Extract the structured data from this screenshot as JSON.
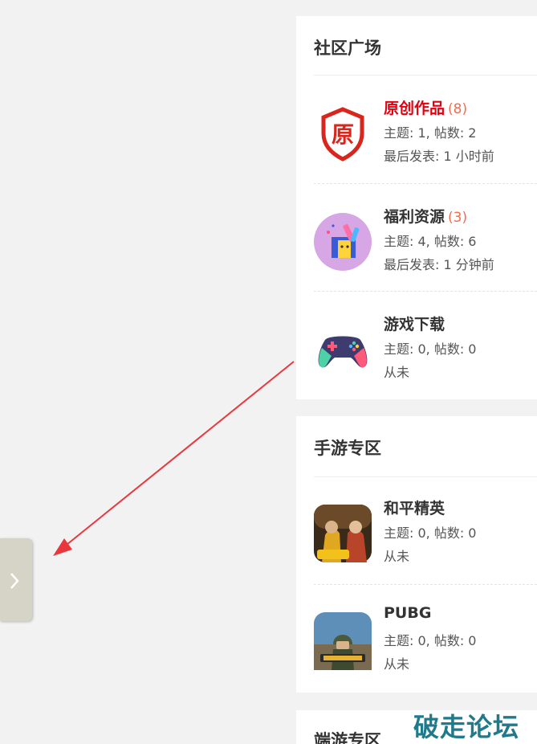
{
  "sections": [
    {
      "title": "社区广场",
      "forums": [
        {
          "name": "原创作品",
          "count": "(8)",
          "stats": "主题: 1, 帖数: 2",
          "last": "最后发表: 1 小时前",
          "icon": "shield-original-icon"
        },
        {
          "name": "福利资源",
          "count": "(3)",
          "stats": "主题: 4, 帖数: 6",
          "last": "最后发表: 1 分钟前",
          "icon": "gift-box-icon"
        },
        {
          "name": "游戏下载",
          "count": "",
          "stats": "主题: 0, 帖数: 0",
          "last": "从未",
          "icon": "gamepad-icon"
        }
      ]
    },
    {
      "title": "手游专区",
      "forums": [
        {
          "name": "和平精英",
          "count": "",
          "stats": "主题: 0, 帖数: 0",
          "last": "从未",
          "icon": "peace-elite-game-icon"
        },
        {
          "name": "PUBG",
          "count": "",
          "stats": "主题: 0, 帖数: 0",
          "last": "从未",
          "icon": "pubg-game-icon"
        }
      ]
    },
    {
      "title": "端游专区"
    }
  ],
  "watermark": "破走论坛",
  "colors": {
    "accent_red": "#e4000f",
    "count_orange": "#f26c4f",
    "arrow_red": "#e8383d",
    "watermark": "#1f7a8c"
  }
}
